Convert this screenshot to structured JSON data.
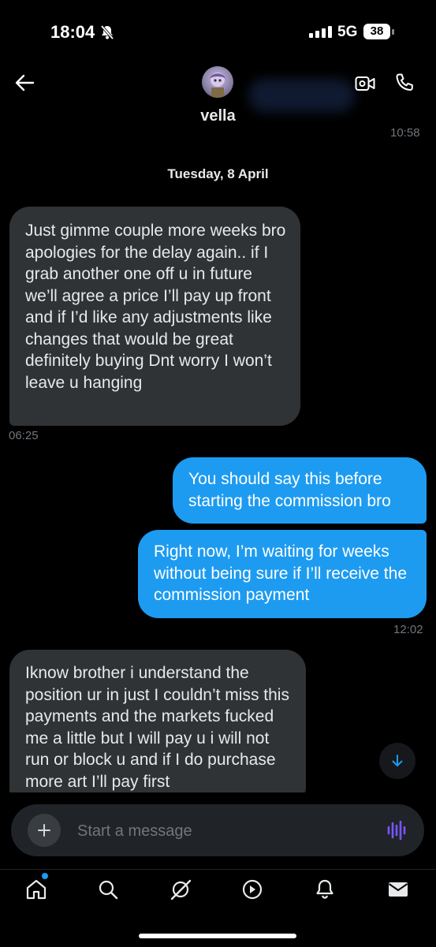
{
  "status_bar": {
    "time": "18:04",
    "network": "5G",
    "battery": "38",
    "icons": [
      "bell-slash-icon",
      "signal-icon",
      "battery-icon"
    ]
  },
  "header": {
    "contact_name": "vella",
    "icons": [
      "back-arrow-icon",
      "video-call-icon",
      "phone-icon"
    ],
    "previous_timestamp": "10:58"
  },
  "conversation": {
    "date_separator": "Tuesday, 8 April",
    "messages": [
      {
        "direction": "received",
        "text": "Just gimme couple more weeks bro apologies for the delay again.. if I grab another one off u in future we’ll agree a price I’ll pay up front and if I’d like any adjustments like changes that would be great definitely buying Dnt worry I won’t leave u hanging"
      },
      {
        "direction": "received_time",
        "text": "06:25"
      },
      {
        "direction": "sent",
        "text": "You should say this before starting the commission bro"
      },
      {
        "direction": "sent",
        "text": "Right now, I’m waiting for weeks without being sure if I’ll receive the commission payment"
      },
      {
        "direction": "sent_time",
        "text": "12:02"
      },
      {
        "direction": "received",
        "text": "Iknow brother i understand the position ur in just I couldn’t miss this payments and the markets fucked me a little but I will pay u i will not run or block u and if I do purchase more art I’ll pay first"
      }
    ]
  },
  "composer": {
    "placeholder": "Start a message",
    "icons": [
      "plus-icon",
      "voice-wave-icon"
    ]
  },
  "bottom_nav": {
    "items": [
      "home-icon",
      "search-icon",
      "grok-icon",
      "video-icon",
      "notifications-icon",
      "messages-icon"
    ]
  },
  "colors": {
    "background": "#000000",
    "sent_bubble": "#1d9bf0",
    "received_bubble": "#2f3336",
    "muted_text": "#71767b",
    "voice_accent": "#7856ff"
  }
}
